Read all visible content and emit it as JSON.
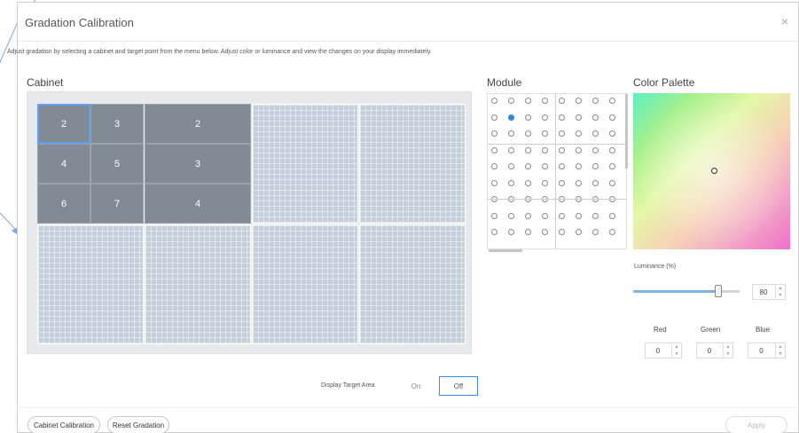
{
  "title": "Gradation Calibration",
  "close_glyph": "×",
  "description": "Adjust gradation by selecting a cabinet and target point from the menu below. Adjust color or luminance and view the changes on your display immediately.",
  "cabinet": {
    "label": "Cabinet",
    "modules": [
      {
        "label": "2",
        "selected": true
      },
      {
        "label": "3",
        "selected": false
      },
      {
        "label": "4",
        "selected": false
      },
      {
        "label": "5",
        "selected": false
      },
      {
        "label": "6",
        "selected": false
      },
      {
        "label": "7",
        "selected": false
      },
      {
        "label": "2",
        "selected": false
      },
      {
        "label": "3",
        "selected": false
      },
      {
        "label": "4",
        "selected": false
      }
    ]
  },
  "module": {
    "label": "Module",
    "selected_row": 2,
    "selected_col": 2
  },
  "palette": {
    "label": "Color Palette"
  },
  "luminance": {
    "label": "Luminance (%)",
    "value": "80",
    "fraction": 0.8
  },
  "rgb": {
    "red_label": "Red",
    "green_label": "Green",
    "blue_label": "Blue",
    "red_value": "0",
    "green_value": "0",
    "blue_value": "0"
  },
  "target_area": {
    "label": "Display Target Area",
    "on_label": "On",
    "off_label": "Off",
    "selected": "Off"
  },
  "footer": {
    "cabinet_calibration": "Cabinet Calibration",
    "reset_gradation": "Reset Gradation",
    "apply": "Apply"
  },
  "colors": {
    "accent": "#3b8ee8",
    "module_fill": "#818a95",
    "cabinet_fill": "#c3cfdb"
  }
}
